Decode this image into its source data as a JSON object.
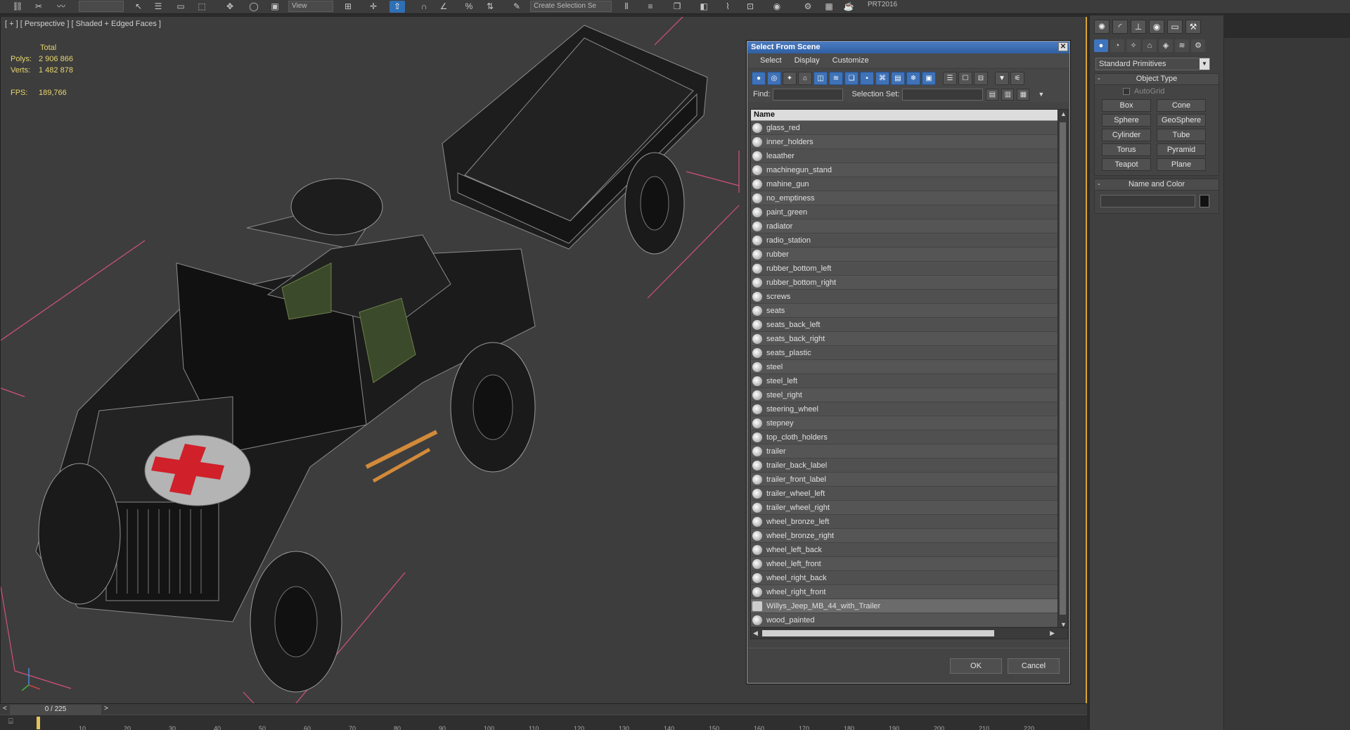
{
  "toolbar": {
    "drop_view": "View",
    "drop_create_selection": "Create Selection Se",
    "prt_label": "PRT2016"
  },
  "viewport": {
    "label": "[ + ] [ Perspective ] [ Shaded + Edged Faces ]",
    "stats": {
      "total_label": "Total",
      "polys_label": "Polys:",
      "polys_value": "2 906 866",
      "verts_label": "Verts:",
      "verts_value": "1 482 878",
      "fps_label": "FPS:",
      "fps_value": "189,766"
    }
  },
  "dialog": {
    "title": "Select From Scene",
    "menu": [
      "Select",
      "Display",
      "Customize"
    ],
    "find_label": "Find:",
    "find_value": "",
    "selection_set_label": "Selection Set:",
    "selection_set_value": "",
    "column_header": "Name",
    "items": [
      "glass_red",
      "inner_holders",
      "leaather",
      "machinegun_stand",
      "mahine_gun",
      "no_emptiness",
      "paint_green",
      "radiator",
      "radio_station",
      "rubber",
      "rubber_bottom_left",
      "rubber_bottom_right",
      "screws",
      "seats",
      "seats_back_left",
      "seats_back_right",
      "seats_plastic",
      "steel",
      "steel_left",
      "steel_right",
      "steering_wheel",
      "stepney",
      "top_cloth_holders",
      "trailer",
      "trailer_back_label",
      "trailer_front_label",
      "trailer_wheel_left",
      "trailer_wheel_right",
      "wheel_bronze_left",
      "wheel_bronze_right",
      "wheel_left_back",
      "wheel_left_front",
      "wheel_right_back",
      "wheel_right_front",
      "Willys_Jeep_MB_44_with_Trailer",
      "wood_painted"
    ],
    "selected_item": "Willys_Jeep_MB_44_with_Trailer",
    "ok_label": "OK",
    "cancel_label": "Cancel"
  },
  "command_panel": {
    "category_dropdown": "Standard Primitives",
    "object_type_title": "Object Type",
    "autogrid_label": "AutoGrid",
    "primitives": [
      "Box",
      "Cone",
      "Sphere",
      "GeoSphere",
      "Cylinder",
      "Tube",
      "Torus",
      "Pyramid",
      "Teapot",
      "Plane"
    ],
    "name_color_title": "Name and Color",
    "object_name_value": ""
  },
  "timeline": {
    "frame_label": "0 / 225",
    "ticks": [
      "10",
      "20",
      "30",
      "40",
      "50",
      "60",
      "70",
      "80",
      "90",
      "100",
      "110",
      "120",
      "130",
      "140",
      "150",
      "160",
      "170",
      "180",
      "190",
      "200",
      "210",
      "220"
    ]
  },
  "colors": {
    "accent_blue": "#3f72b7",
    "viewport_border": "#d7a534",
    "stats_yellow": "#e6d56e",
    "red_cross": "#d0202a"
  }
}
